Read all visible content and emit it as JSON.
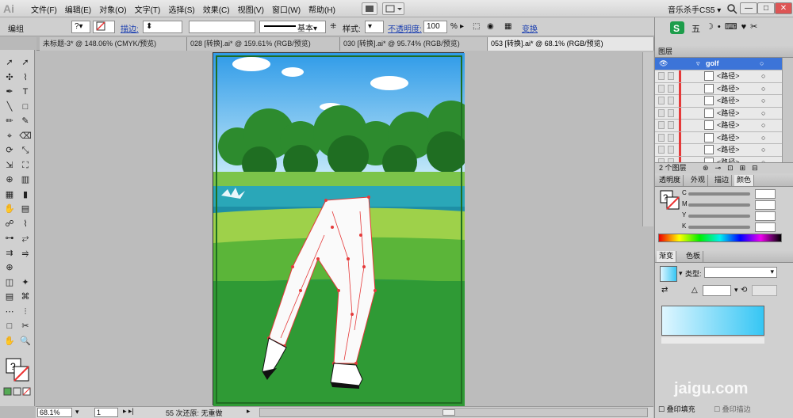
{
  "app": {
    "logo": "Ai",
    "name": "音乐杀手CS5"
  },
  "menu": [
    "文件(F)",
    "编辑(E)",
    "对象(O)",
    "文字(T)",
    "选择(S)",
    "效果(C)",
    "视图(V)",
    "窗口(W)",
    "帮助(H)"
  ],
  "window_controls": {
    "minimize": "—",
    "maximize": "□",
    "close": "✕"
  },
  "control": {
    "group_label": "编组",
    "stroke_label": "描边:",
    "stroke_style": "基本",
    "style_label": "样式:",
    "opacity_label": "不透明度:",
    "opacity_value": "100",
    "percent": "%",
    "transform_label": "变换"
  },
  "tabs": [
    {
      "label": "未标题-3* @ 148.06% (CMYK/预览)"
    },
    {
      "label": "028 [转换].ai* @ 159.61% (RGB/预览)"
    },
    {
      "label": "030 [转换].ai* @ 95.74% (RGB/预览)"
    },
    {
      "label": "053 [转换].ai* @ 68.1% (RGB/预览)"
    }
  ],
  "status": {
    "zoom": "68.1%",
    "page": "1",
    "undo": "55 次还原: 无重做"
  },
  "ime": {
    "char": "五"
  },
  "layers_panel": {
    "title": "图层",
    "top_layer": "golf",
    "items": [
      "<路径>",
      "<路径>",
      "<路径>",
      "<路径>",
      "<路径>",
      "<路径>",
      "<路径>",
      "<路径>"
    ],
    "footer": "2 个图层"
  },
  "color_panel": {
    "tabs": [
      "透明度",
      "外观",
      "描边",
      "颜色"
    ],
    "channels": [
      "C",
      "M",
      "Y",
      "K"
    ]
  },
  "gradient_panel": {
    "tabs": [
      "渐变",
      "色板"
    ],
    "type_label": "类型:",
    "start": "#dff6ff",
    "end": "#36c6f4"
  },
  "bottom_panel": {
    "fill_label": "叠印填充",
    "stroke_label": "叠印描边"
  },
  "watermark": "jaigu.com",
  "colors": {
    "accent": "#1b3fb0",
    "layer_select": "#3c74d8",
    "anchor": "#e53a3a"
  }
}
